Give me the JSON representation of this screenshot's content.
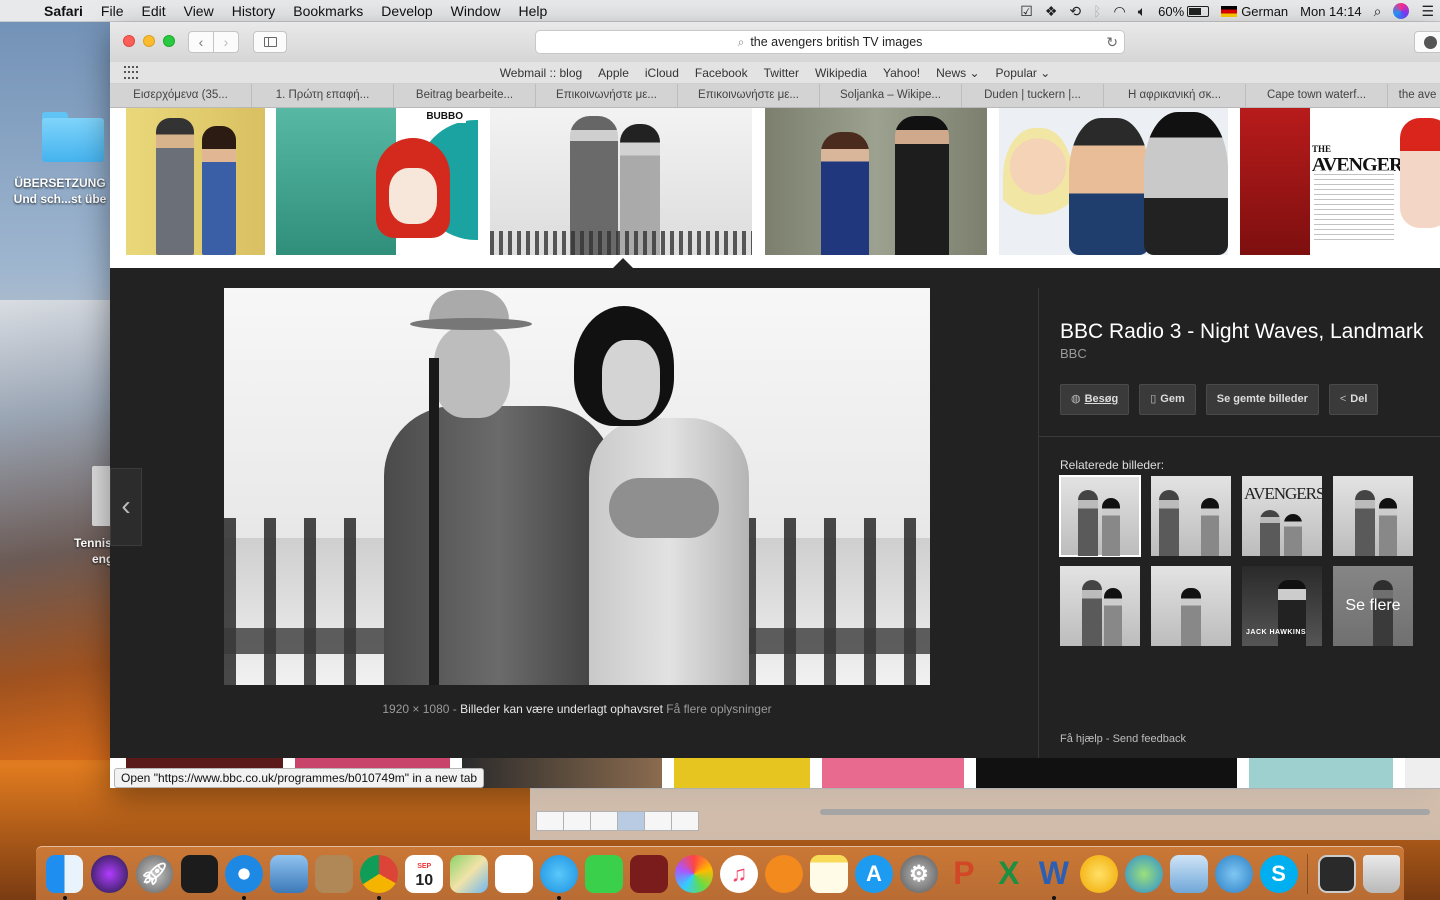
{
  "menubar": {
    "app_name": "Safari",
    "items": [
      "File",
      "Edit",
      "View",
      "History",
      "Bookmarks",
      "Develop",
      "Window",
      "Help"
    ],
    "battery": "60%",
    "input_source": "German",
    "clock": "Mon 14:14"
  },
  "desktop": {
    "folder_label_1": "ÜBERSETZUNG",
    "folder_label_2": "Und sch...st übe",
    "item_label_1": "Tennis",
    "item_label_2": "eng"
  },
  "browser": {
    "url_text": "the avengers british TV images",
    "favorites": [
      "Webmail :: blog",
      "Apple",
      "iCloud",
      "Facebook",
      "Twitter",
      "Wikipedia",
      "Yahoo!",
      "News ⌄",
      "Popular ⌄"
    ],
    "tabs": [
      "Εισερχόμενα (35...",
      "1. Πρώτη επαφή...",
      "Beitrag bearbeite...",
      "Επικοινωνήστε με...",
      "Επικοινωνήστε με...",
      "Soljanka – Wikipe...",
      "Duden | tuckern |...",
      "Η αφρικανική σκ...",
      "Cape town waterf...",
      "the ave"
    ]
  },
  "thumbnails": {
    "th2_logo": "BUBBO",
    "th6_title_line1": "THE",
    "th6_title_line2": "AVENGERS"
  },
  "preview": {
    "dimensions": "1920 × 1080",
    "separator": "-",
    "copyright": "Billeder kan være underlagt ophavsret",
    "more_info": "Få flere oplysninger",
    "title": "BBC Radio 3 - Night Waves, Landmark",
    "source": "BBC",
    "actions": {
      "visit": "Besøg",
      "save": "Gem",
      "saved": "Se gemte billeder",
      "share": "Del"
    },
    "related_label": "Relaterede billeder:",
    "related_avengers": "AVENGERS",
    "related_jack": "JACK HAWKINS",
    "see_more": "Se flere",
    "footer_help": "Få hjælp",
    "footer_feedback": "Send feedback"
  },
  "status_tip": "Open \"https://www.bbc.co.uk/programmes/b010749m\" in a new tab",
  "dock_icons": [
    "finder-icon",
    "siri-icon",
    "launchpad-icon",
    "photo-booth-icon",
    "safari-icon",
    "preview-icon",
    "contacts-icon",
    "chrome-icon",
    "calendar-icon",
    "maps-icon",
    "reminders-icon",
    "messages-icon",
    "facetime-icon",
    "photo-icon",
    "photos-icon",
    "itunes-icon",
    "ibooks-icon",
    "notes-icon",
    "app-store-icon",
    "system-preferences-icon",
    "powerpoint-icon",
    "excel-icon",
    "word-icon",
    "slack-icon",
    "network-icon",
    "utility-icon",
    "family-icon",
    "skype-icon",
    "screen-icon",
    "trash-icon"
  ],
  "calendar_day": "10",
  "calendar_month": "SEP"
}
